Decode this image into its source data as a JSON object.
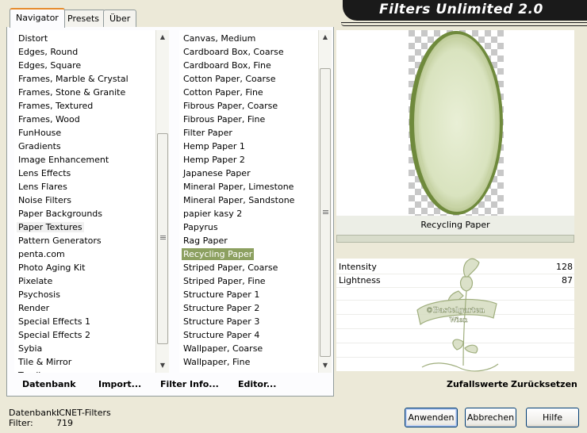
{
  "app": {
    "title": "Filters Unlimited 2.0"
  },
  "tabs": [
    {
      "label": "Navigator",
      "active": true
    },
    {
      "label": "Presets",
      "active": false
    },
    {
      "label": "Über",
      "active": false
    }
  ],
  "categories": {
    "items": [
      "Distort",
      "Edges, Round",
      "Edges, Square",
      "Frames, Marble & Crystal",
      "Frames, Stone & Granite",
      "Frames, Textured",
      "Frames, Wood",
      "FunHouse",
      "Gradients",
      "Image Enhancement",
      "Lens Effects",
      "Lens Flares",
      "Noise Filters",
      "Paper Backgrounds",
      "Paper Textures",
      "Pattern Generators",
      "penta.com",
      "Photo Aging Kit",
      "Pixelate",
      "Psychosis",
      "Render",
      "Special Effects 1",
      "Special Effects 2",
      "Sybia",
      "Tile & Mirror",
      "Toadies"
    ],
    "selected": "Paper Textures"
  },
  "filters": {
    "items": [
      "Canvas, Medium",
      "Cardboard Box, Coarse",
      "Cardboard Box, Fine",
      "Cotton Paper, Coarse",
      "Cotton Paper, Fine",
      "Fibrous Paper, Coarse",
      "Fibrous Paper, Fine",
      "Filter Paper",
      "Hemp Paper 1",
      "Hemp Paper 2",
      "Japanese Paper",
      "Mineral Paper, Limestone",
      "Mineral Paper, Sandstone",
      "papier kasy 2",
      "Papyrus",
      "Rag Paper",
      "Recycling Paper",
      "Striped Paper, Coarse",
      "Striped Paper, Fine",
      "Structure Paper 1",
      "Structure Paper 2",
      "Structure Paper 3",
      "Structure Paper 4",
      "Wallpaper, Coarse",
      "Wallpaper, Fine"
    ],
    "selected": "Recycling Paper"
  },
  "left_buttons": {
    "datenbank": "Datenbank",
    "import": "Import...",
    "filter_info": "Filter Info...",
    "editor": "Editor..."
  },
  "preview": {
    "filter_name": "Recycling Paper"
  },
  "params": [
    {
      "name": "Intensity",
      "value": "128"
    },
    {
      "name": "Lightness",
      "value": "87"
    }
  ],
  "watermark_text": [
    "©Bastelgarten",
    "Wien"
  ],
  "right_buttons": {
    "random": "Zufallswerte",
    "reset": "Zurücksetzen"
  },
  "status": {
    "db_label": "Datenbank:",
    "db_value": "ICNET-Filters",
    "filter_label": "Filter:",
    "filter_value": "719"
  },
  "dialog_buttons": {
    "apply": "Anwenden",
    "cancel": "Abbrechen",
    "help": "Hilfe"
  },
  "colors": {
    "accent_green": "#8ca060",
    "tab_highlight": "#e68b2c",
    "banner_bg": "#1a1a1a"
  }
}
